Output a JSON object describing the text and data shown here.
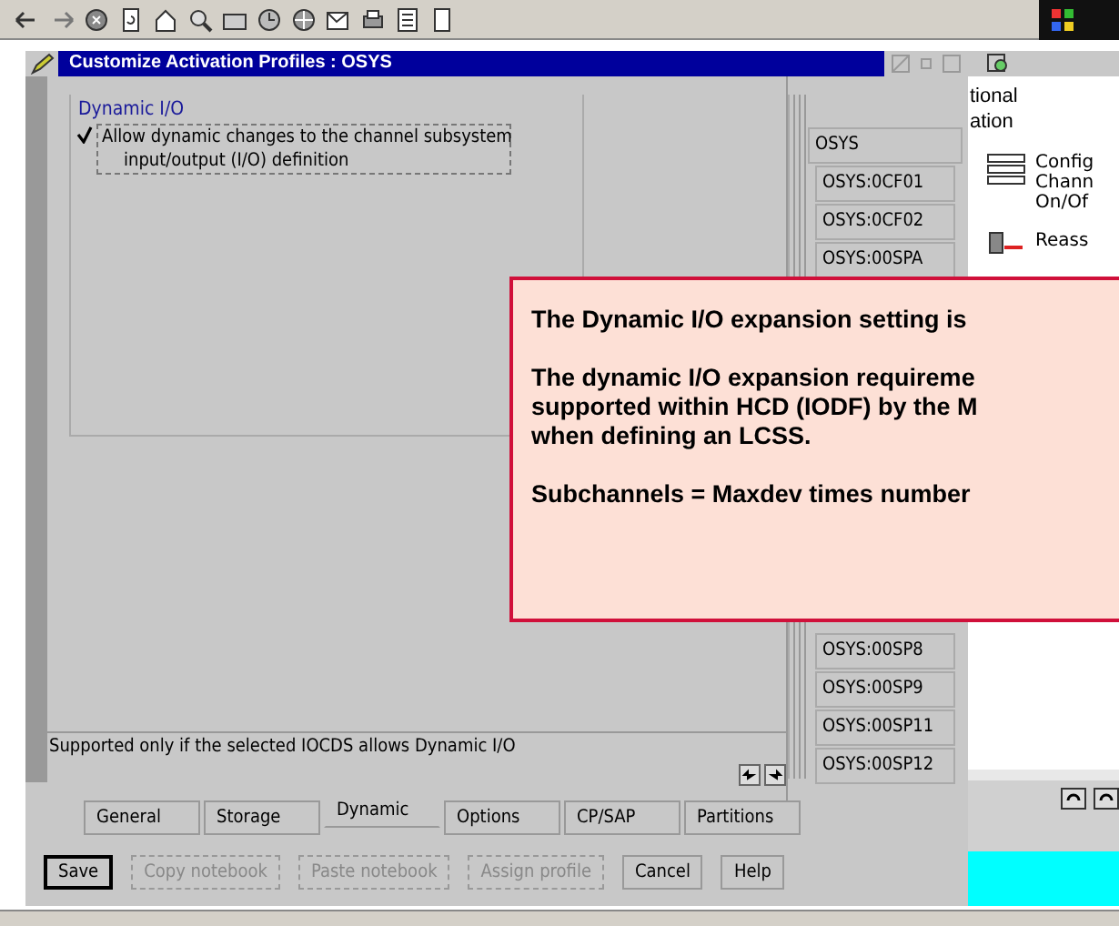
{
  "background_window": {
    "header_lines": [
      "tional",
      "ation"
    ],
    "items": [
      {
        "kind": "channels",
        "lines": [
          "Config",
          "Chann",
          "On/Of"
        ]
      },
      {
        "kind": "reassign",
        "lines": [
          "Reass"
        ]
      }
    ]
  },
  "dialog": {
    "title": "Customize Activation Profiles : OSYS",
    "group": {
      "title": "Dynamic I/O",
      "option": {
        "label_lines": [
          "Allow dynamic changes to the channel subsystem",
          "input/output (I/O) definition"
        ],
        "checked": true
      }
    },
    "status_text": "Supported only if the selected IOCDS allows Dynamic I/O",
    "profiles": [
      {
        "label": "OSYS",
        "selected": true
      },
      {
        "label": "OSYS:0CF01",
        "selected": false
      },
      {
        "label": "OSYS:0CF02",
        "selected": false
      },
      {
        "label": "OSYS:00SPA",
        "selected": false
      },
      {
        "label": "OSYS:00SP8",
        "selected": false
      },
      {
        "label": "OSYS:00SP9",
        "selected": false
      },
      {
        "label": "OSYS:00SP11",
        "selected": false
      },
      {
        "label": "OSYS:00SP12",
        "selected": false
      }
    ],
    "tabs": [
      {
        "label": "General",
        "selected": false
      },
      {
        "label": "Storage",
        "selected": false
      },
      {
        "label": "Dynamic",
        "selected": true
      },
      {
        "label": "Options",
        "selected": false
      },
      {
        "label": "CP/SAP",
        "selected": false
      },
      {
        "label": "Partitions",
        "selected": false
      }
    ],
    "buttons": [
      {
        "label": "Save",
        "disabled": false,
        "default": true
      },
      {
        "label": "Copy notebook",
        "disabled": true,
        "default": false
      },
      {
        "label": "Paste notebook",
        "disabled": true,
        "default": false
      },
      {
        "label": "Assign profile",
        "disabled": true,
        "default": false
      },
      {
        "label": "Cancel",
        "disabled": false,
        "default": false
      },
      {
        "label": "Help",
        "disabled": false,
        "default": false
      }
    ]
  },
  "callout": {
    "paragraphs": [
      [
        "The Dynamic I/O expansion setting is"
      ],
      [
        "The dynamic I/O expansion requireme",
        "supported within HCD (IODF) by the M",
        "when defining an LCSS."
      ],
      [
        "Subchannels = Maxdev times number"
      ]
    ]
  }
}
